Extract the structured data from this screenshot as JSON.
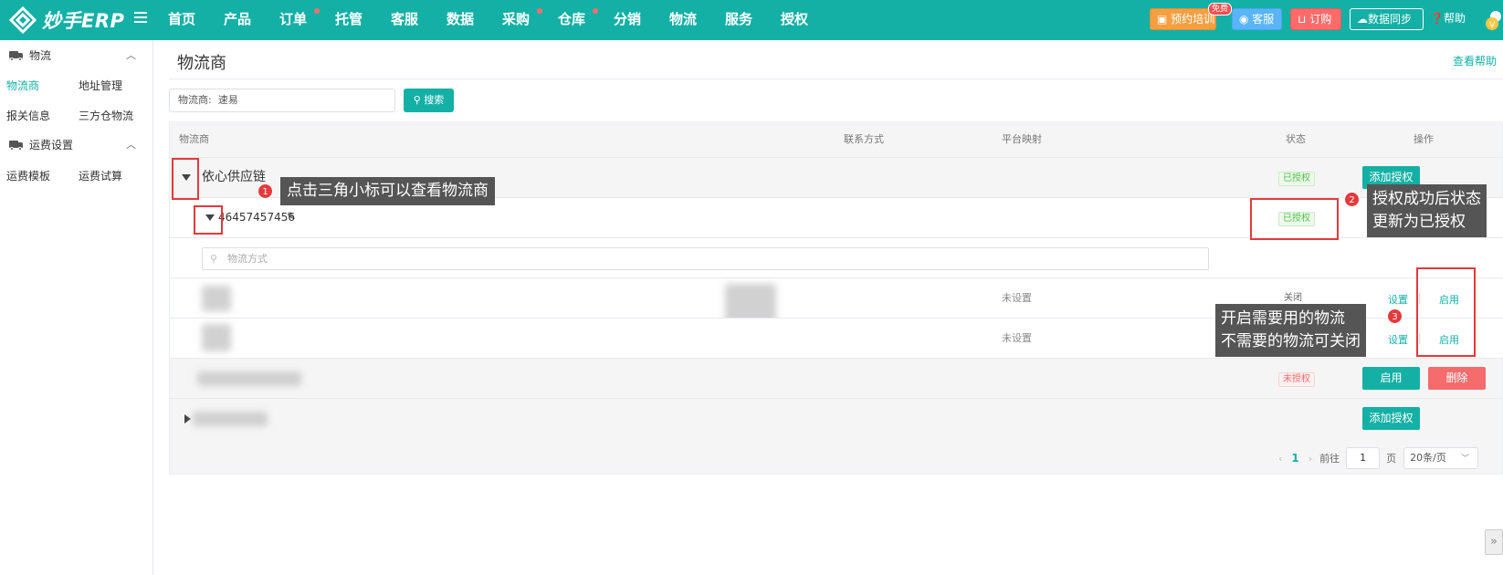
{
  "header": {
    "logo_text": "妙手ERP",
    "nav": [
      "首页",
      "产品",
      "订单",
      "托管",
      "客服",
      "数据",
      "采购",
      "仓库",
      "分销",
      "物流",
      "服务",
      "授权"
    ],
    "training": "预约培训",
    "training_badge": "免费",
    "service": "客服",
    "order": "订购",
    "sync": "数据同步",
    "help": "帮助"
  },
  "sidebar": {
    "group1": "物流",
    "group1_links": [
      "物流商",
      "地址管理",
      "报关信息",
      "三方仓物流"
    ],
    "group2": "运费设置",
    "group2_links": [
      "运费模板",
      "运费试算"
    ]
  },
  "main": {
    "title": "物流商",
    "help_link": "查看帮助",
    "search_label": "物流商:",
    "search_value": "速易",
    "search_button": "搜索",
    "columns": [
      "物流商",
      "联系方式",
      "平台映射",
      "状态",
      "操作"
    ],
    "provider_name": "依心供应链",
    "account_id": "46457457456",
    "method_placeholder": "物流方式",
    "unset": "未设置",
    "status_authorized": "已授权",
    "status_unauthorized": "未授权",
    "status_off": "关闭",
    "btn_add_auth": "添加授权",
    "btn_enable": "启用",
    "btn_delete": "删除",
    "link_set": "设置",
    "link_enable": "启用"
  },
  "pagination": {
    "current": "1",
    "goto": "前往",
    "page_input": "1",
    "page_unit": "页",
    "page_size": "20条/页"
  },
  "annotations": {
    "n1": "1",
    "n2": "2",
    "n3": "3",
    "c1": "点击三角小标可以查看物流商",
    "c2_line1": "授权成功后状态",
    "c2_line2": "更新为已授权",
    "c3_line1": "开启需要用的物流",
    "c3_line2": "不需要的物流可关闭"
  },
  "colors": {
    "brand": "#14b0a6",
    "annotation_red": "#e5393b",
    "callout_bg": "#555555"
  }
}
